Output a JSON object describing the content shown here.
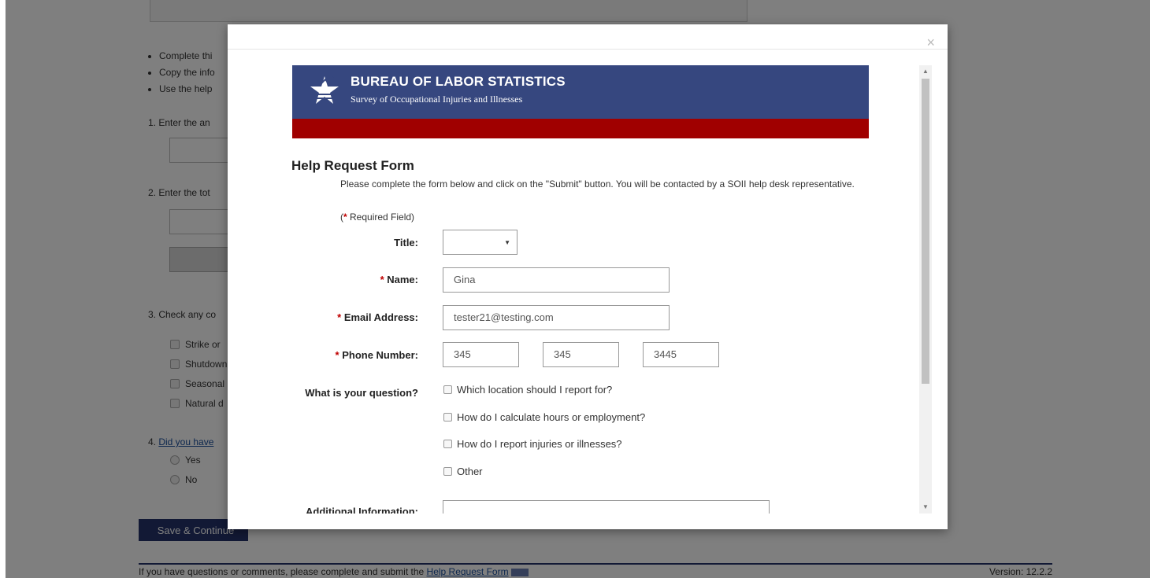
{
  "background": {
    "bullets": [
      "Complete thi",
      "Copy the info",
      "Use the help"
    ],
    "steps": {
      "step1": "1. Enter the an",
      "step2": "2. Enter the tot",
      "step3": "3. Check any co",
      "step4_prefix": "4. ",
      "step4_link": "Did you have"
    },
    "checkboxes": [
      "Strike or",
      "Shutdown",
      "Seasonal",
      "Natural d"
    ],
    "radios": [
      "Yes",
      "No"
    ],
    "save_button": "Save & Continue",
    "footer_text": "If you have questions or comments, please complete and submit the ",
    "footer_link": "Help Request Form",
    "version": "Version: 12.2.2"
  },
  "modal": {
    "close_label": "×",
    "banner": {
      "title": "BUREAU OF LABOR STATISTICS",
      "subtitle": "Survey of Occupational Injuries and Illnesses"
    },
    "form": {
      "heading": "Help Request Form",
      "intro": "Please complete the form below and click on the \"Submit\" button. You will be contacted by a SOII help desk representative.",
      "required_note_open": "(",
      "required_star": "*",
      "required_note_text": " Required Field)",
      "title_label": "Title:",
      "title_value": "",
      "name_label": "Name:",
      "name_value": "Gina",
      "email_label": "Email Address:",
      "email_value": "tester21@testing.com",
      "phone_label": "Phone Number:",
      "phone_area": "345",
      "phone_prefix": "345",
      "phone_line": "3445",
      "question_label": "What is your question?",
      "questions": [
        "Which location should I report for?",
        "How do I calculate hours or employment?",
        "How do I report injuries or illnesses?",
        "Other"
      ],
      "additional_label": "Additional Information:",
      "star": "*"
    }
  },
  "colors": {
    "banner_blue": "#36477f",
    "banner_red": "#a00000",
    "required_red": "#c00000",
    "save_button_navy": "#24336a"
  }
}
